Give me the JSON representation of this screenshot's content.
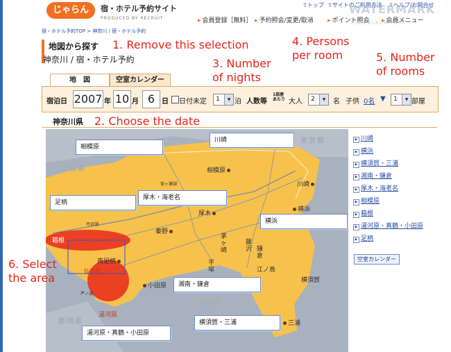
{
  "header": {
    "logo_text": "じゃらん",
    "site_title": "宿・ホテル予約サイト",
    "produced_by": "PRODUCED BY RECRUIT",
    "nav": [
      "会員登録［無料］",
      "予約照会/変更/取消",
      "ポイント照会",
      "会員メニュー"
    ],
    "top_links": [
      "トップ",
      "サイトのご利用方法",
      "ヘルプ/お問合せ"
    ],
    "watermark": "WATERMARK",
    "watermark_sub": "FULL ALBUM PACK"
  },
  "breadcrumb": [
    "宿・ホテル予約TOP",
    "神奈川",
    "宿・ホテル予約"
  ],
  "page": {
    "title": "地図から探す",
    "subtitle": "神奈川 / 宿・ホテル予約"
  },
  "tabs": [
    {
      "label": "地　図",
      "active": true
    },
    {
      "label": "空室カレンダー",
      "active": false
    }
  ],
  "form": {
    "checkin_label": "宿泊日",
    "year": "2007",
    "year_unit": "年",
    "month": "10",
    "month_unit": "月",
    "day": "6",
    "day_unit": "日",
    "undecided_label": "日付未定",
    "nights": "1",
    "nights_unit": "泊",
    "persons_label": "人数等",
    "per_room_label_1": "1部屋",
    "per_room_label_2": "あたり",
    "adult_label": "大人",
    "adults": "2",
    "adult_unit": "名",
    "child_label": "子供",
    "children": "0名",
    "rooms": "1",
    "rooms_unit": "部屋"
  },
  "prefecture": "神奈川県",
  "annotations": {
    "a1": "1. Remove this selection",
    "a2": "2. Choose the date",
    "a3_1": "3. Number",
    "a3_2": "of nights",
    "a4_1": "4. Persons",
    "a4_2": "per room",
    "a5_1": "5. Number",
    "a5_2": "of rooms",
    "a6_1": "6. Select",
    "a6_2": "the area"
  },
  "map": {
    "region_labels": [
      "東京都",
      "山梨県",
      "静岡県",
      "相模湾"
    ],
    "area_boxes": [
      "相模原",
      "川崎",
      "厚木・海老名",
      "足柄",
      "横浜",
      "箱根",
      "湘南・鎌倉",
      "横須賀・三浦",
      "湯河原・真鶴・小田原"
    ],
    "places": [
      "相模原",
      "川崎",
      "厚木",
      "横浜",
      "秦野",
      "茅ヶ崎",
      "藤沢",
      "鎌倉",
      "平塚",
      "江ノ島",
      "南足柄",
      "小田原",
      "湯河原",
      "横須賀",
      "三浦",
      "宮ヶ瀬湖",
      "丹沢湖",
      "仙石原",
      "芦ノ湖"
    ],
    "colors": {
      "land": "#f7c24b",
      "sea": "#a8b2bf",
      "highlight": "#e8231b",
      "box_border": "#6d8bc9"
    }
  },
  "area_list": [
    "川崎",
    "横浜",
    "横須賀・三浦",
    "湘南・鎌倉",
    "厚木・海老名",
    "相模原",
    "箱根",
    "湯河原・真鶴・小田原",
    "足柄"
  ],
  "calendar_button": "空室カレンダー"
}
